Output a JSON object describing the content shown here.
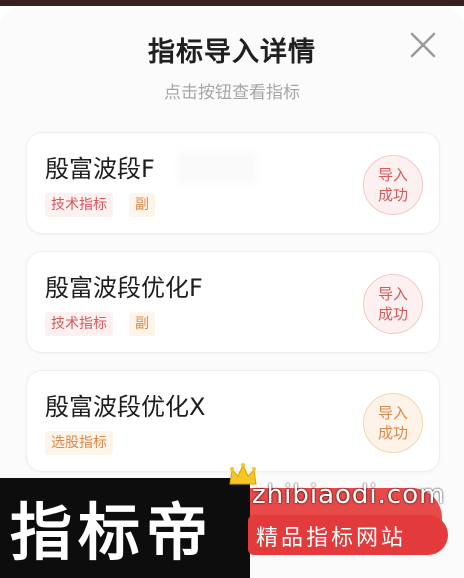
{
  "dialog": {
    "title": "指标导入详情",
    "subtitle": "点击按钮查看指标"
  },
  "items": [
    {
      "name": "殷富波段F",
      "tags": [
        "技术指标",
        "副"
      ],
      "status": "导入成功"
    },
    {
      "name": "殷富波段优化F",
      "tags": [
        "技术指标",
        "副"
      ],
      "status": "导入成功"
    },
    {
      "name": "殷富波段优化X",
      "tags": [
        "选股指标"
      ],
      "status": "导入成功"
    }
  ],
  "bottom_button": {
    "visible_label": "指标"
  },
  "watermark": {
    "brand": "指标帝",
    "domain": "zhibiaodi.com",
    "slogan": "精品指标网站"
  },
  "colors": {
    "accent_red": "#e84a4a",
    "tag_red": "#d45a5a",
    "tag_orange": "#d9894a"
  },
  "icons": {
    "close": "close-icon",
    "crown": "crown-icon"
  }
}
